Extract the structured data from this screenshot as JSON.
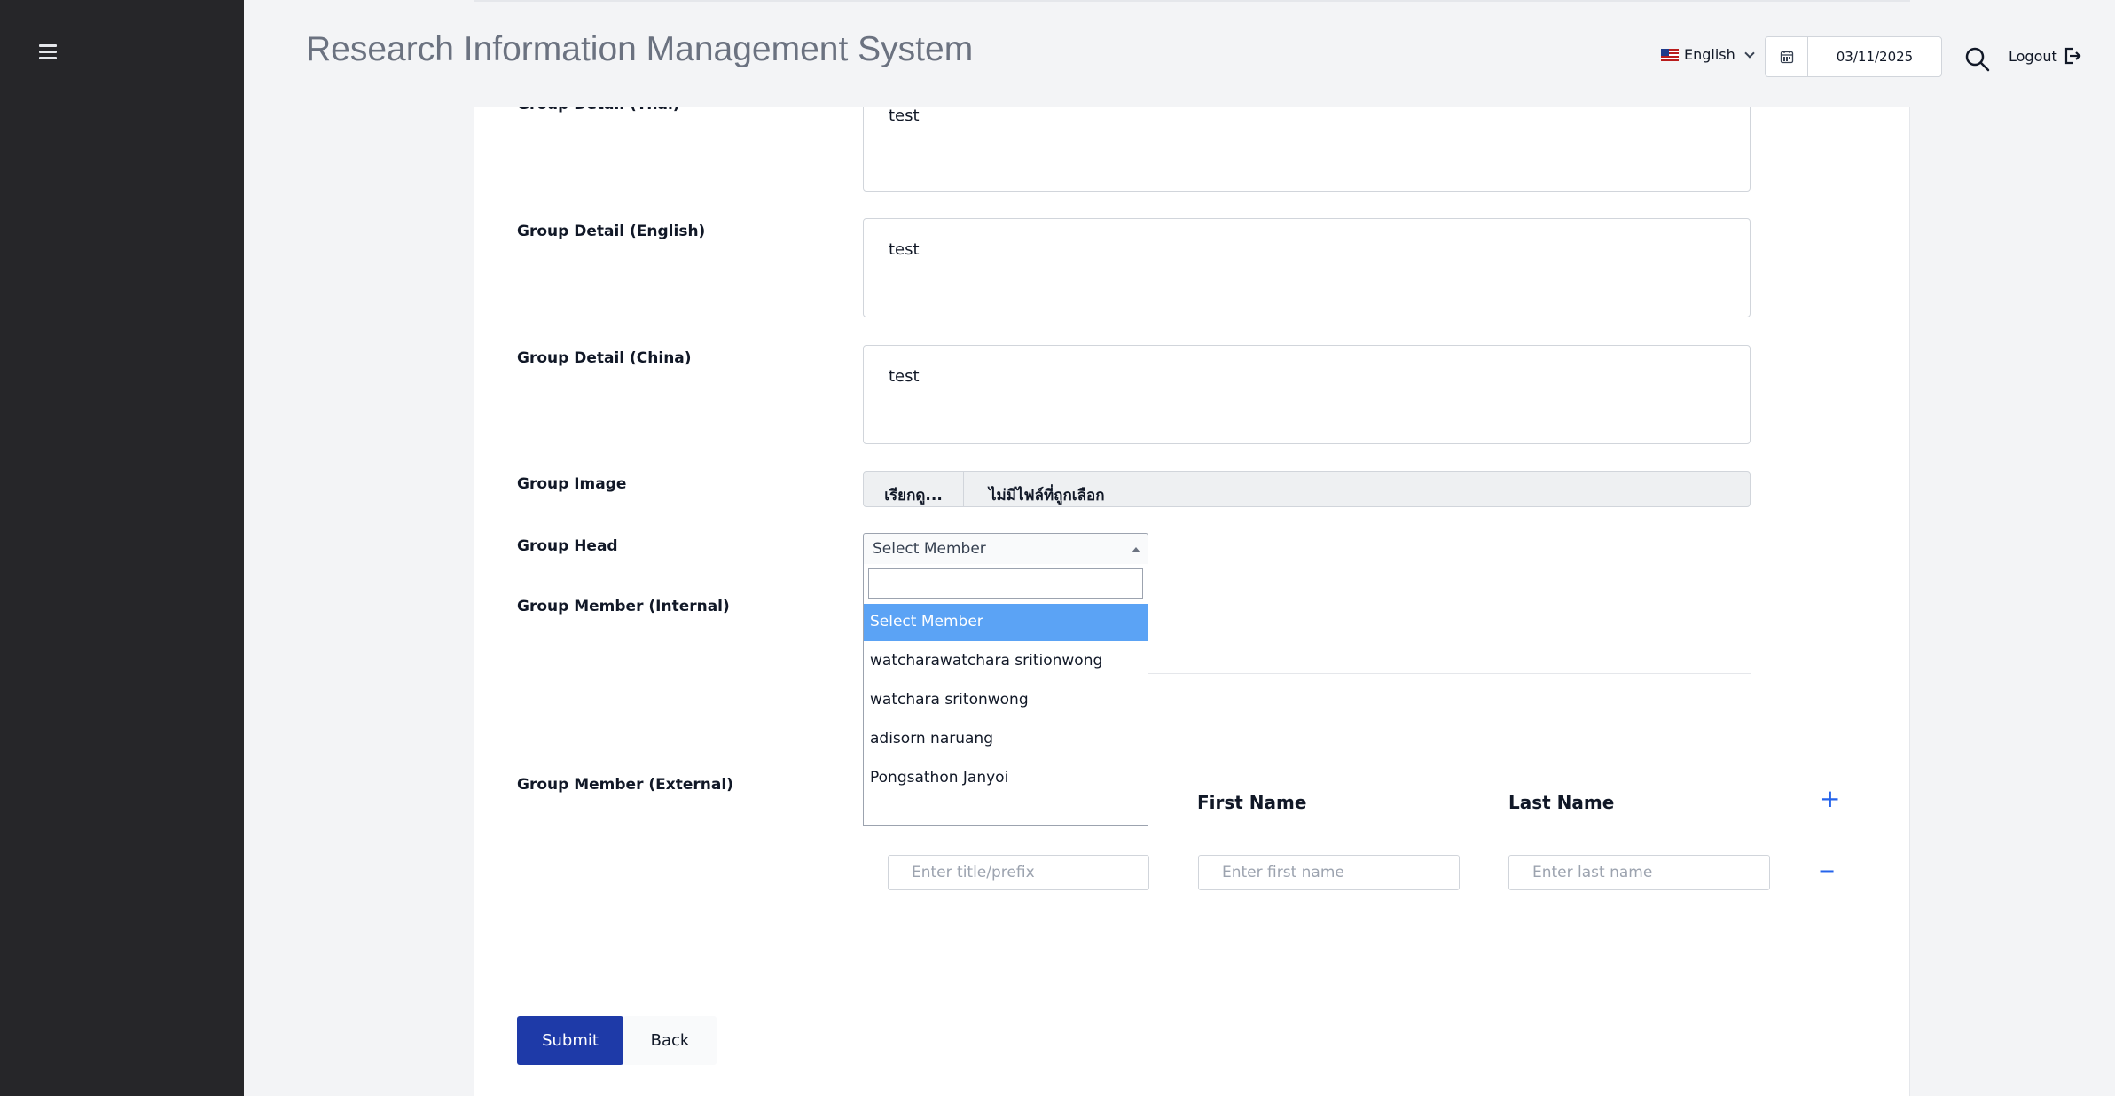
{
  "header": {
    "title": "Research Information Management System",
    "language": "English",
    "date": "03/11/2025",
    "logout_label": "Logout"
  },
  "form": {
    "detail_thai": {
      "label": "Group Detail (Thai)",
      "value": "test"
    },
    "detail_english": {
      "label": "Group Detail (English)",
      "value": "test"
    },
    "detail_china": {
      "label": "Group Detail (China)",
      "value": "test"
    },
    "image": {
      "label": "Group Image",
      "button": "เรียกดู...",
      "status": "ไม่มีไฟล์ที่ถูกเลือก"
    },
    "head": {
      "label": "Group Head",
      "selected": "Select Member",
      "options": [
        "Select Member",
        "watcharawatchara sritionwong",
        "watchara sritonwong",
        "adisorn naruang",
        "Pongsathon Janyoi"
      ]
    },
    "member_internal": {
      "label": "Group Member (Internal)"
    },
    "member_external": {
      "label": "Group Member (External)",
      "columns": [
        "First Name",
        "Last Name"
      ],
      "placeholders": {
        "title": "Enter title/prefix",
        "first": "Enter first name",
        "last": "Enter last name"
      },
      "add": "+",
      "remove": "−"
    }
  },
  "actions": {
    "submit": "Submit",
    "back": "Back"
  }
}
